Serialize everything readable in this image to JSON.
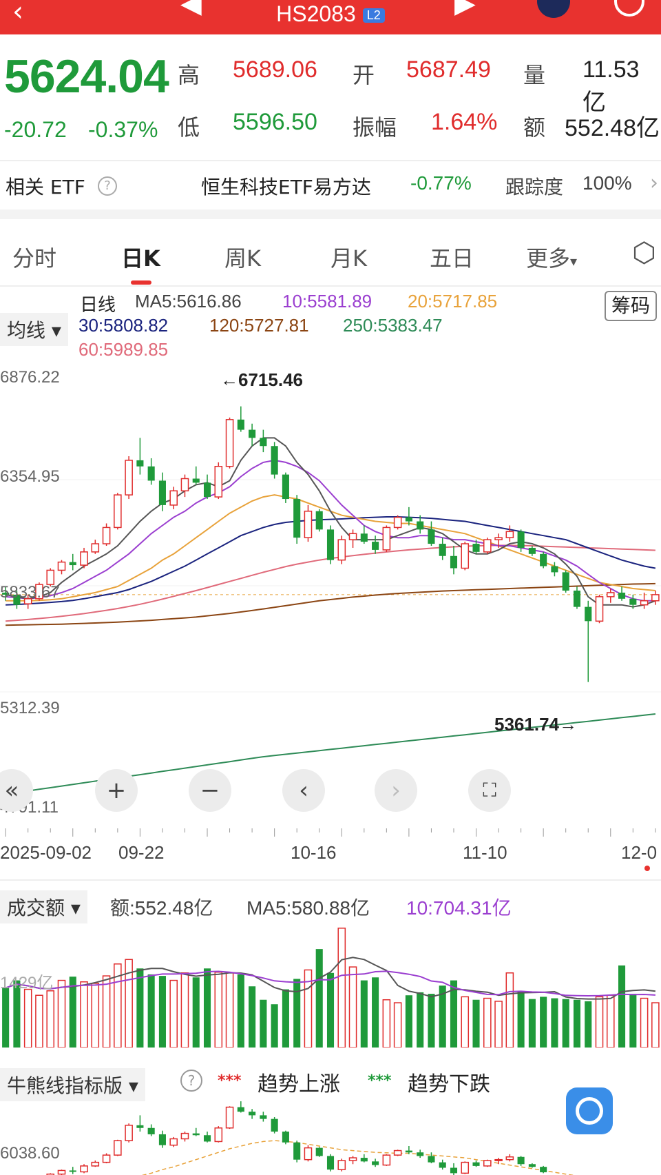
{
  "header": {
    "title": "HS2083",
    "badge": "L2"
  },
  "quote": {
    "price": "5624.04",
    "change": "-20.72",
    "change_pct": "-0.37%",
    "high_label": "高",
    "high": "5689.06",
    "open_label": "开",
    "open": "5687.49",
    "vol_label": "量",
    "vol": "11.53亿",
    "low_label": "低",
    "low": "5596.50",
    "amp_label": "振幅",
    "amp": "1.64%",
    "amt_label": "额",
    "amt": "552.48亿"
  },
  "etf": {
    "label": "相关 ETF",
    "name": "恒生科技ETF易方达",
    "change": "-0.77%",
    "track_label": "跟踪度",
    "track": "100%"
  },
  "tabs": [
    "分时",
    "日K",
    "周K",
    "月K",
    "五日",
    "更多"
  ],
  "ma_legend": {
    "prefix": "日线",
    "ma5": "MA5:5616.86",
    "ma10": "10:5581.89",
    "ma20": "20:5717.85",
    "ma30": "30:5808.82",
    "ma120": "120:5727.81",
    "ma250": "250:5383.47",
    "ma60": "60:5989.85",
    "selector": "均线",
    "chip": "筹码"
  },
  "price_axis": [
    "6876.22",
    "6354.95",
    "5833.67",
    "5312.39",
    "4791.11"
  ],
  "annotations": {
    "high": "←6715.46",
    "low": "5361.74→"
  },
  "dates": [
    "2025-09-02",
    "09-22",
    "10-16",
    "11-10",
    "12-0"
  ],
  "volume": {
    "selector": "成交额",
    "amt": "额:552.48亿",
    "ma5": "MA5:580.88亿",
    "ma10": "10:704.31亿",
    "axis": "1429亿"
  },
  "indicator": {
    "selector": "牛熊线指标版",
    "up_marks": "***",
    "up": "趋势上涨",
    "down_marks": "***",
    "down": "趋势下跌",
    "axis": "6038.60"
  },
  "colors": {
    "up": "#e02c2c",
    "down": "#1f9a3a",
    "accent": "#e8322f"
  },
  "chart_data": {
    "type": "candlestick",
    "candles": [
      [
        5800,
        5830,
        5760,
        5790
      ],
      [
        5790,
        5810,
        5720,
        5740
      ],
      [
        5745,
        5790,
        5720,
        5770
      ],
      [
        5770,
        5850,
        5760,
        5840
      ],
      [
        5840,
        5920,
        5830,
        5910
      ],
      [
        5910,
        5960,
        5890,
        5950
      ],
      [
        5950,
        5990,
        5910,
        5935
      ],
      [
        5935,
        6020,
        5920,
        6000
      ],
      [
        6000,
        6060,
        5990,
        6040
      ],
      [
        6040,
        6140,
        6030,
        6120
      ],
      [
        6120,
        6290,
        6110,
        6280
      ],
      [
        6280,
        6470,
        6260,
        6450
      ],
      [
        6450,
        6560,
        6380,
        6420
      ],
      [
        6420,
        6460,
        6330,
        6350
      ],
      [
        6350,
        6390,
        6200,
        6230
      ],
      [
        6230,
        6320,
        6210,
        6300
      ],
      [
        6300,
        6380,
        6270,
        6360
      ],
      [
        6360,
        6420,
        6330,
        6340
      ],
      [
        6340,
        6380,
        6260,
        6270
      ],
      [
        6270,
        6440,
        6260,
        6420
      ],
      [
        6420,
        6660,
        6410,
        6650
      ],
      [
        6650,
        6715,
        6590,
        6600
      ],
      [
        6600,
        6630,
        6520,
        6560
      ],
      [
        6560,
        6600,
        6490,
        6520
      ],
      [
        6520,
        6540,
        6360,
        6380
      ],
      [
        6380,
        6390,
        6240,
        6260
      ],
      [
        6260,
        6280,
        6040,
        6070
      ],
      [
        6070,
        6230,
        6050,
        6200
      ],
      [
        6200,
        6210,
        6100,
        6110
      ],
      [
        6110,
        6130,
        5940,
        5960
      ],
      [
        5960,
        6080,
        5940,
        6060
      ],
      [
        6060,
        6110,
        6020,
        6090
      ],
      [
        6090,
        6130,
        6040,
        6050
      ],
      [
        6050,
        6080,
        5990,
        6010
      ],
      [
        6010,
        6130,
        6000,
        6120
      ],
      [
        6120,
        6180,
        6110,
        6170
      ],
      [
        6170,
        6220,
        6130,
        6150
      ],
      [
        6150,
        6180,
        6090,
        6110
      ],
      [
        6110,
        6150,
        6030,
        6040
      ],
      [
        6040,
        6070,
        5960,
        5980
      ],
      [
        5980,
        6030,
        5890,
        5920
      ],
      [
        5920,
        6050,
        5910,
        6040
      ],
      [
        6040,
        6060,
        5990,
        6000
      ],
      [
        6000,
        6070,
        5990,
        6060
      ],
      [
        6060,
        6090,
        6020,
        6070
      ],
      [
        6070,
        6130,
        6050,
        6100
      ],
      [
        6100,
        6110,
        6000,
        6020
      ],
      [
        6020,
        6030,
        5980,
        5990
      ],
      [
        5990,
        6000,
        5920,
        5930
      ],
      [
        5930,
        5950,
        5880,
        5900
      ],
      [
        5900,
        5910,
        5800,
        5810
      ],
      [
        5810,
        5830,
        5720,
        5730
      ],
      [
        5730,
        5760,
        5361,
        5660
      ],
      [
        5660,
        5790,
        5650,
        5780
      ],
      [
        5780,
        5820,
        5750,
        5800
      ],
      [
        5800,
        5830,
        5760,
        5770
      ],
      [
        5770,
        5790,
        5720,
        5740
      ],
      [
        5740,
        5800,
        5720,
        5760
      ],
      [
        5760,
        5810,
        5740,
        5790
      ]
    ],
    "ma5": [
      5790,
      5780,
      5770,
      5780,
      5800,
      5850,
      5890,
      5930,
      5960,
      5990,
      6030,
      6090,
      6150,
      6200,
      6240,
      6260,
      6300,
      6330,
      6340,
      6320,
      6350,
      6450,
      6520,
      6560,
      6560,
      6520,
      6440,
      6380,
      6300,
      6200,
      6120,
      6060,
      6060,
      6060,
      6060,
      6080,
      6100,
      6120,
      6110,
      6090,
      6050,
      6010,
      5990,
      5990,
      6010,
      6040,
      6050,
      6040,
      6020,
      5990,
      5940,
      5880,
      5780,
      5740,
      5740,
      5740,
      5730,
      5740,
      5760
    ],
    "ma10": [
      5780,
      5775,
      5770,
      5775,
      5785,
      5800,
      5820,
      5850,
      5880,
      5910,
      5950,
      5990,
      6040,
      6090,
      6130,
      6170,
      6200,
      6240,
      6270,
      6290,
      6320,
      6370,
      6410,
      6440,
      6450,
      6440,
      6420,
      6390,
      6350,
      6290,
      6230,
      6180,
      6130,
      6100,
      6080,
      6070,
      6070,
      6080,
      6080,
      6070,
      6060,
      6060,
      6050,
      6040,
      6030,
      6030,
      6020,
      6010,
      6000,
      5980,
      5960,
      5930,
      5890,
      5850,
      5820,
      5790,
      5770,
      5760,
      5760
    ],
    "ma20": [
      5760,
      5760,
      5760,
      5762,
      5765,
      5770,
      5780,
      5790,
      5800,
      5815,
      5830,
      5860,
      5890,
      5920,
      5960,
      5990,
      6030,
      6070,
      6110,
      6150,
      6190,
      6220,
      6250,
      6270,
      6280,
      6270,
      6260,
      6240,
      6220,
      6200,
      6180,
      6170,
      6160,
      6150,
      6145,
      6140,
      6140,
      6130,
      6120,
      6110,
      6100,
      6090,
      6070,
      6050,
      6030,
      6010,
      5990,
      5970,
      5950,
      5930,
      5910,
      5890,
      5870,
      5850,
      5840,
      5830,
      5820,
      5815,
      5810
    ],
    "ma30": [
      5740,
      5742,
      5745,
      5748,
      5752,
      5756,
      5762,
      5770,
      5780,
      5790,
      5800,
      5815,
      5835,
      5855,
      5880,
      5905,
      5930,
      5960,
      5990,
      6020,
      6050,
      6080,
      6100,
      6120,
      6135,
      6145,
      6150,
      6155,
      6158,
      6160,
      6162,
      6165,
      6168,
      6170,
      6172,
      6172,
      6170,
      6168,
      6165,
      6160,
      6155,
      6150,
      6140,
      6130,
      6120,
      6110,
      6100,
      6090,
      6080,
      6070,
      6060,
      6040,
      6020,
      6000,
      5980,
      5960,
      5945,
      5930,
      5920
    ],
    "ma60": [
      5660,
      5664,
      5668,
      5673,
      5678,
      5684,
      5690,
      5697,
      5705,
      5713,
      5722,
      5732,
      5743,
      5755,
      5768,
      5782,
      5796,
      5810,
      5825,
      5840,
      5855,
      5870,
      5885,
      5900,
      5914,
      5928,
      5940,
      5950,
      5960,
      5968,
      5975,
      5982,
      5988,
      5994,
      6000,
      6005,
      6010,
      6014,
      6018,
      6022,
      6025,
      6028,
      6030,
      6031,
      6032,
      6032,
      6031,
      6030,
      6028,
      6026,
      6024,
      6022,
      6020,
      6018,
      6016,
      6014,
      6012,
      6010,
      6008
    ],
    "ma120": [
      5640,
      5641,
      5642,
      5643,
      5644,
      5645,
      5647,
      5649,
      5651,
      5653,
      5655,
      5658,
      5661,
      5664,
      5668,
      5672,
      5676,
      5680,
      5686,
      5692,
      5698,
      5705,
      5712,
      5720,
      5728,
      5736,
      5744,
      5752,
      5760,
      5766,
      5772,
      5778,
      5783,
      5788,
      5792,
      5796,
      5799,
      5802,
      5805,
      5808,
      5810,
      5812,
      5814,
      5816,
      5818,
      5820,
      5822,
      5824,
      5826,
      5828,
      5830,
      5832,
      5834,
      5836,
      5838,
      5840,
      5842,
      5843,
      5844
    ],
    "ma250": [
      4810,
      4818,
      4826,
      4834,
      4842,
      4850,
      4858,
      4866,
      4874,
      4882,
      4890,
      4898,
      4906,
      4914,
      4922,
      4930,
      4938,
      4946,
      4954,
      4962,
      4970,
      4978,
      4986,
      4994,
      5000,
      5006,
      5012,
      5018,
      5024,
      5030,
      5036,
      5042,
      5048,
      5054,
      5060,
      5066,
      5072,
      5078,
      5084,
      5090,
      5096,
      5102,
      5108,
      5114,
      5120,
      5126,
      5132,
      5138,
      5144,
      5150,
      5156,
      5162,
      5168,
      5174,
      5180,
      5186,
      5192,
      5198,
      5204
    ],
    "volumes": [
      800,
      900,
      780,
      700,
      760,
      900,
      950,
      880,
      860,
      960,
      1120,
      1180,
      1060,
      980,
      960,
      900,
      1000,
      940,
      1060,
      1010,
      1000,
      980,
      820,
      640,
      580,
      780,
      920,
      1040,
      1320,
      1000,
      1600,
      1080,
      900,
      940,
      640,
      600,
      700,
      740,
      720,
      830,
      900,
      680,
      640,
      660,
      620,
      1000,
      750,
      650,
      680,
      660,
      650,
      640,
      620,
      680,
      700,
      1100,
      720,
      660,
      600
    ],
    "ylim": [
      4791.11,
      6876.22
    ]
  }
}
